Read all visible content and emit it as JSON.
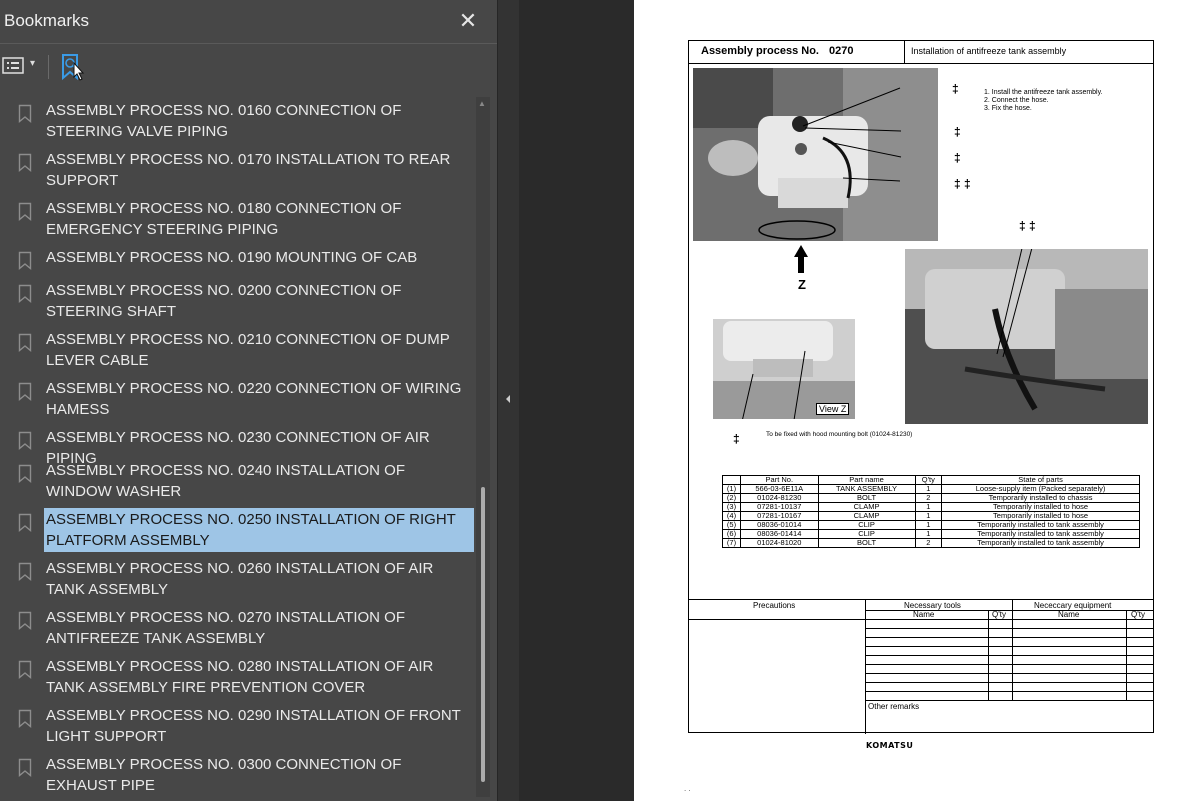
{
  "panel": {
    "title": "Bookmarks",
    "close_symbol": "✕",
    "toolbar": {
      "options_icon": "list-options-icon",
      "options_caret": "▾",
      "find_icon": "find-bookmark-icon"
    }
  },
  "bookmarks": [
    {
      "label": "ASSEMBLY PROCESS NO. 0160 CONNECTION OF STEERING VALVE PIPING"
    },
    {
      "label": "ASSEMBLY PROCESS NO. 0170 INSTALLATION TO REAR SUPPORT"
    },
    {
      "label": "ASSEMBLY PROCESS NO. 0180 CONNECTION OF EMERGENCY STEERING PIPING"
    },
    {
      "label": "ASSEMBLY PROCESS NO. 0190 MOUNTING OF CAB"
    },
    {
      "label": "ASSEMBLY PROCESS NO. 0200 CONNECTION OF STEERING SHAFT"
    },
    {
      "label": "ASSEMBLY PROCESS NO. 0210 CONNECTION OF DUMP LEVER CABLE"
    },
    {
      "label": "ASSEMBLY PROCESS NO. 0220 CONNECTION OF WIRING HAMESS"
    },
    {
      "label": "ASSEMBLY PROCESS NO. 0230 CONNECTION OF AIR PIPING"
    },
    {
      "label": "ASSEMBLY PROCESS NO. 0240 INSTALLATION OF WINDOW WASHER"
    },
    {
      "label": "ASSEMBLY PROCESS NO. 0250 INSTALLATION OF RIGHT PLATFORM ASSEMBLY",
      "selected": true
    },
    {
      "label": "ASSEMBLY PROCESS NO. 0260 INSTALLATION OF AIR TANK ASSEMBLY"
    },
    {
      "label": "ASSEMBLY PROCESS NO. 0270 INSTALLATION OF ANTIFREEZE TANK ASSEMBLY"
    },
    {
      "label": "ASSEMBLY PROCESS NO. 0280 INSTALLATION OF AIR TANK ASSEMBLY FIRE PREVENTION COVER"
    },
    {
      "label": "ASSEMBLY PROCESS NO. 0290 INSTALLATION OF FRONT LIGHT SUPPORT"
    },
    {
      "label": "ASSEMBLY PROCESS NO. 0300 CONNECTION OF EXHAUST PIPE"
    }
  ],
  "colors": {
    "panel_bg": "#474747",
    "selected_bg": "#9ec5e6",
    "find_icon": "#3a9be6"
  },
  "document": {
    "proc_label": "Assembly process No.",
    "proc_no": "0270",
    "title": "Installation of antifreeze tank assembly",
    "instructions": [
      "1. Install the antifreeze tank assembly.",
      "2. Connect the hose.",
      "3. Fix the hose."
    ],
    "callout_symbol": "‡",
    "callout_double": "‡ ‡",
    "view_label": "Z",
    "view_box": "View Z",
    "bolt_note": "To be fixed with hood mounting bolt (01024-81230)",
    "parts_headers": [
      "",
      "Part No.",
      "Part name",
      "Q'ty",
      "State of parts"
    ],
    "parts_rows": [
      [
        "(1)",
        "566-03-6E11A",
        "TANK ASSEMBLY",
        "1",
        "Loose-supply item (Packed separately)"
      ],
      [
        "(2)",
        "01024-81230",
        "BOLT",
        "2",
        "Temporarily installed to chassis"
      ],
      [
        "(3)",
        "07281-10137",
        "CLAMP",
        "1",
        "Temporarily installed to hose"
      ],
      [
        "(4)",
        "07281-10167",
        "CLAMP",
        "1",
        "Temporarily installed to hose"
      ],
      [
        "(5)",
        "08036-01014",
        "CLIP",
        "1",
        "Temporarily installed to tank assembly"
      ],
      [
        "(6)",
        "08036-01414",
        "CLIP",
        "1",
        "Temporarily installed to tank assembly"
      ],
      [
        "(7)",
        "01024-81020",
        "BOLT",
        "2",
        "Temporarily installed to tank assembly"
      ]
    ],
    "bottom": {
      "precautions": "Precautions",
      "tools": "Necessary tools",
      "equipment": "Nececcary equipment",
      "name": "Name",
      "qty": "Q'ty",
      "other_remarks": "Other remarks"
    },
    "logo": "KOMATSU",
    "page_dots": ". ."
  }
}
